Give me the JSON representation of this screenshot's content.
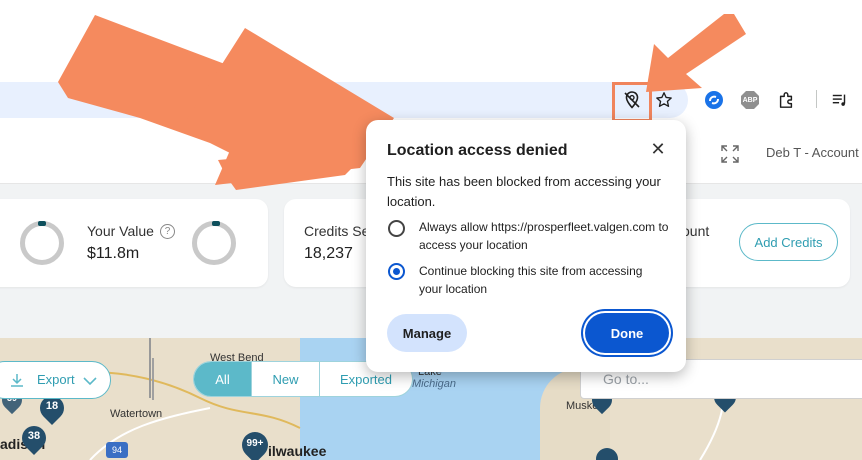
{
  "toolbar": {
    "location_blocked_icon": "location-off-icon",
    "bookmark_icon": "star-icon",
    "extensions": [
      "sync-extension-icon",
      "adblock-icon",
      "puzzle-icon",
      "media-control-icon"
    ],
    "adblock_label": "ABP"
  },
  "header": {
    "account_label": "Deb T - Account"
  },
  "stats": {
    "your_value_label": "Your Value",
    "your_value": "$11.8m",
    "credits_label": "Credits Se",
    "credits_value": "18,237",
    "amount_label": "ount",
    "add_credits_label": "Add Credits"
  },
  "map": {
    "export_label": "Export",
    "filters": [
      "All",
      "New",
      "Exported"
    ],
    "active_filter": "All",
    "goto_placeholder": "Go to...",
    "labels": {
      "west_bend": "West Bend",
      "watertown": "Watertown",
      "milwaukee": "ilwaukee",
      "madison": "adison",
      "lake": "Michigan",
      "lake_prefix": "Lake",
      "muskegon": "Muskeo",
      "route": "94"
    },
    "pins": [
      "18",
      "38",
      "99+",
      "39"
    ]
  },
  "popup": {
    "title": "Location access denied",
    "description": "This site has been blocked from accessing your location.",
    "options": [
      "Always allow https://prosperfleet.valgen.com to access your location",
      "Continue blocking this site from accessing your location"
    ],
    "selected_index": 1,
    "manage_label": "Manage",
    "done_label": "Done"
  },
  "colors": {
    "accent": "#5cb9c9",
    "primary_blue": "#0b57d0",
    "annotation_arrow": "#f58a5e",
    "pin": "#244e6b"
  }
}
